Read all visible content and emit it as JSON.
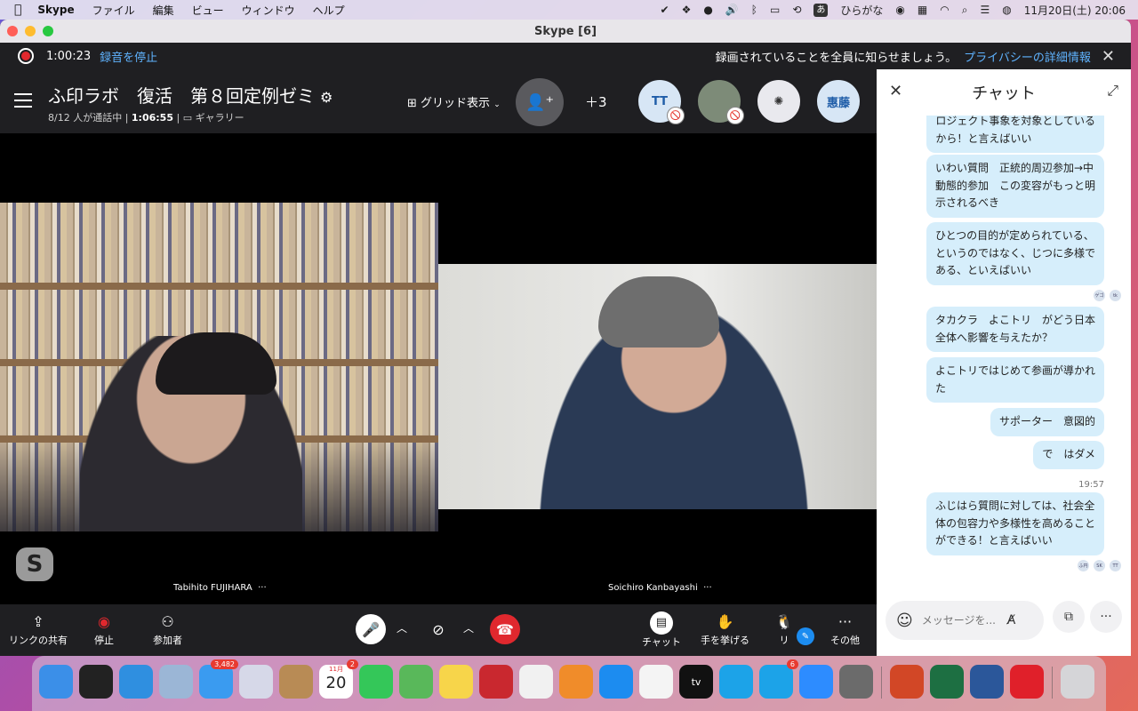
{
  "menubar": {
    "apple": "",
    "app": "Skype",
    "items": [
      "ファイル",
      "編集",
      "ビュー",
      "ウィンドウ",
      "ヘルプ"
    ],
    "ime_box": "あ",
    "ime": "ひらがな",
    "clock": "11月20日(土)  20:06"
  },
  "window": {
    "title": "Skype [6]"
  },
  "recording": {
    "time": "1:00:23",
    "stop_label": "録音を停止",
    "notice": "録画されていることを全員に知らせましょう。",
    "privacy_link": "プライバシーの詳細情報"
  },
  "call": {
    "title": "ふ印ラボ　復活　第８回定例ゼミ",
    "participants": "8/12 人が通話中",
    "duration": "1:06:55",
    "view_mode": "ギャラリー",
    "grid_label": "グリッド表示",
    "extra_count": "＋3",
    "avatars": [
      {
        "label": "TT",
        "bg": "#d7e6f5",
        "fg": "#1f5da8"
      },
      {
        "label": "",
        "bg": "#7d8b78",
        "fg": "#fff"
      },
      {
        "label": "",
        "bg": "#e9e9ee",
        "fg": "#333"
      },
      {
        "label": "惠藤",
        "bg": "#d7e6f5",
        "fg": "#1f5da8"
      }
    ]
  },
  "videos": {
    "left_name": "Tabihito FUJIHARA",
    "right_name": "Soichiro Kanbayashi",
    "more": "···"
  },
  "toolbar": {
    "share": "リンクの共有",
    "stop": "停止",
    "participants": "参加者",
    "chat": "チャット",
    "raise_hand": "手を挙げる",
    "react": "リ",
    "more": "その他"
  },
  "chat": {
    "title": "チャット",
    "messages": [
      "ロジェクト事象を対象としている\nから！と言えばいい",
      "いわい質問　正統的周辺参加→中\n動態的参加　この変容がもっと明\n示されるべき",
      "ひとつの目的が定められている、\nというのではなく、じつに多様で\nある、といえばいい",
      "タカクラ　よこトリ　がどう日本\n全体へ影響を与えたか？",
      "よこトリではじめて参画が導かれ\nた",
      "サポーター　意図的",
      "で　はダメ",
      "ふじはら質問に対しては、社会全\n体の包容力や多様性を高めること\nができる！と言えばいい"
    ],
    "timestamp": "19:57",
    "read_marks_1": [
      "ゲゴ",
      "tk"
    ],
    "read_marks_2": [
      "ふ円",
      "SK",
      "TT"
    ],
    "placeholder": "メッセージを..."
  },
  "dock": {
    "mail_badge": "3,482",
    "calendar_badge": "2",
    "calendar_month": "11月",
    "calendar_day": "20",
    "tv_label": "tv",
    "skype_badge": "6",
    "apps": [
      {
        "name": "finder",
        "color": "#3b8fe8"
      },
      {
        "name": "pages-like",
        "color": "#222"
      },
      {
        "name": "safari",
        "color": "#2f8fe0"
      },
      {
        "name": "preview",
        "color": "#9bb6d6"
      },
      {
        "name": "mail",
        "color": "#3a9bf0"
      },
      {
        "name": "launchpad",
        "color": "#d6d8e8"
      },
      {
        "name": "contacts",
        "color": "#b88b55"
      },
      {
        "name": "calendar",
        "color": "#ffffff"
      },
      {
        "name": "messages",
        "color": "#34c759"
      },
      {
        "name": "maps",
        "color": "#59b85a"
      },
      {
        "name": "notes",
        "color": "#f7d54a"
      },
      {
        "name": "photobooth",
        "color": "#c9282f"
      },
      {
        "name": "photos",
        "color": "#f1f1f1"
      },
      {
        "name": "books",
        "color": "#f08c2a"
      },
      {
        "name": "appstore",
        "color": "#1c8cf0"
      },
      {
        "name": "reminders",
        "color": "#f4f4f4"
      },
      {
        "name": "appletv",
        "color": "#111"
      },
      {
        "name": "skype1",
        "color": "#1ca3e8"
      },
      {
        "name": "skype2",
        "color": "#1ca3e8"
      },
      {
        "name": "zoom",
        "color": "#2d8cff"
      },
      {
        "name": "keynote-like",
        "color": "#6b6b6b"
      },
      {
        "name": "powerpoint",
        "color": "#d24726"
      },
      {
        "name": "excel",
        "color": "#1d6f42"
      },
      {
        "name": "word",
        "color": "#2b579a"
      },
      {
        "name": "other-red",
        "color": "#e0202a"
      },
      {
        "name": "trash",
        "color": "#d5d5d8"
      }
    ]
  }
}
